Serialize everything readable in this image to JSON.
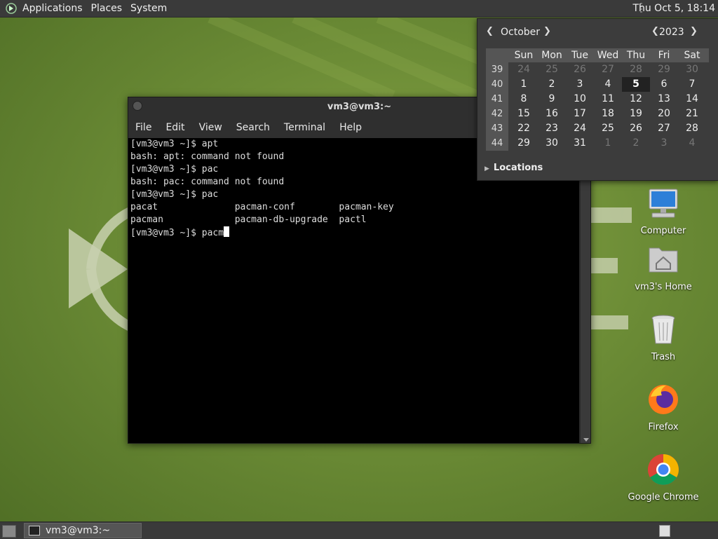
{
  "top_panel": {
    "menus": [
      "Applications",
      "Places",
      "System"
    ],
    "clock": "Thu Oct  5, 18:14"
  },
  "calendar": {
    "month": "October",
    "year": "2023",
    "days_of_week": [
      "Sun",
      "Mon",
      "Tue",
      "Wed",
      "Thu",
      "Fri",
      "Sat"
    ],
    "weeks": [
      {
        "num": "39",
        "days": [
          {
            "d": "24",
            "other": true
          },
          {
            "d": "25",
            "other": true
          },
          {
            "d": "26",
            "other": true
          },
          {
            "d": "27",
            "other": true
          },
          {
            "d": "28",
            "other": true
          },
          {
            "d": "29",
            "other": true
          },
          {
            "d": "30",
            "other": true
          }
        ]
      },
      {
        "num": "40",
        "days": [
          {
            "d": "1"
          },
          {
            "d": "2"
          },
          {
            "d": "3"
          },
          {
            "d": "4"
          },
          {
            "d": "5",
            "today": true
          },
          {
            "d": "6"
          },
          {
            "d": "7"
          }
        ]
      },
      {
        "num": "41",
        "days": [
          {
            "d": "8"
          },
          {
            "d": "9"
          },
          {
            "d": "10"
          },
          {
            "d": "11"
          },
          {
            "d": "12"
          },
          {
            "d": "13"
          },
          {
            "d": "14"
          }
        ]
      },
      {
        "num": "42",
        "days": [
          {
            "d": "15"
          },
          {
            "d": "16"
          },
          {
            "d": "17"
          },
          {
            "d": "18"
          },
          {
            "d": "19"
          },
          {
            "d": "20"
          },
          {
            "d": "21"
          }
        ]
      },
      {
        "num": "43",
        "days": [
          {
            "d": "22"
          },
          {
            "d": "23"
          },
          {
            "d": "24"
          },
          {
            "d": "25"
          },
          {
            "d": "26"
          },
          {
            "d": "27"
          },
          {
            "d": "28"
          }
        ]
      },
      {
        "num": "44",
        "days": [
          {
            "d": "29"
          },
          {
            "d": "30"
          },
          {
            "d": "31"
          },
          {
            "d": "1",
            "other": true
          },
          {
            "d": "2",
            "other": true
          },
          {
            "d": "3",
            "other": true
          },
          {
            "d": "4",
            "other": true
          }
        ]
      }
    ],
    "locations_label": "Locations"
  },
  "terminal": {
    "title": "vm3@vm3:~",
    "menus": [
      "File",
      "Edit",
      "View",
      "Search",
      "Terminal",
      "Help"
    ],
    "lines": [
      "[vm3@vm3 ~]$ apt",
      "bash: apt: command not found",
      "[vm3@vm3 ~]$ pac",
      "bash: pac: command not found",
      "[vm3@vm3 ~]$ pac",
      "pacat              pacman-conf        pacman-key",
      "pacman             pacman-db-upgrade  pactl"
    ],
    "current_input": "[vm3@vm3 ~]$ pacm"
  },
  "desktop_icons": [
    {
      "label": "Computer",
      "icon": "computer-icon"
    },
    {
      "label": "vm3's Home",
      "icon": "home-folder-icon"
    },
    {
      "label": "Trash",
      "icon": "trash-icon"
    },
    {
      "label": "Firefox",
      "icon": "firefox-icon"
    },
    {
      "label": "Google Chrome",
      "icon": "chrome-icon"
    }
  ],
  "taskbar": {
    "window_label": "vm3@vm3:~"
  }
}
